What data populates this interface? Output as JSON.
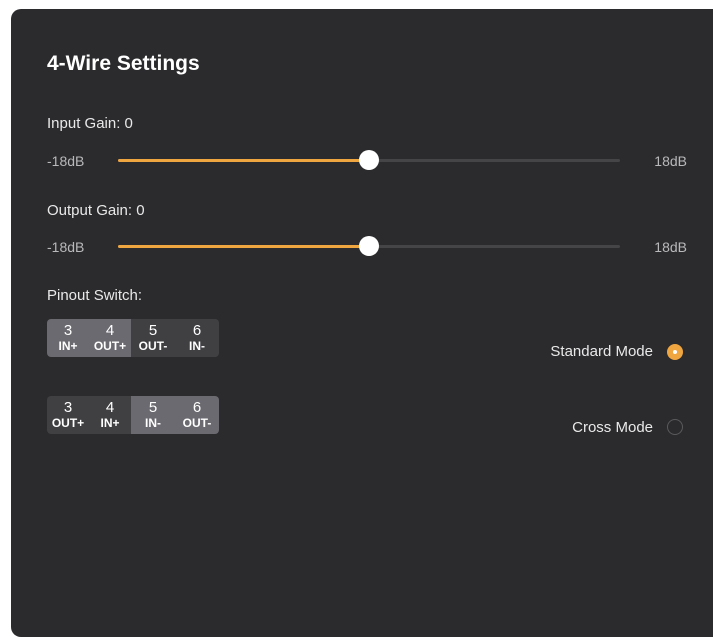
{
  "panel": {
    "title": "4-Wire Settings"
  },
  "input_gain": {
    "label": "Input Gain: 0",
    "min_label": "-18dB",
    "max_label": "18dB",
    "min": -18,
    "max": 18,
    "value": 0
  },
  "output_gain": {
    "label": "Output Gain: 0",
    "min_label": "-18dB",
    "max_label": "18dB",
    "min": -18,
    "max": 18,
    "value": 0
  },
  "pinout": {
    "label": "Pinout Switch:",
    "rows": [
      {
        "pins": [
          {
            "num": "3",
            "sig": "IN+"
          },
          {
            "num": "4",
            "sig": "OUT+"
          },
          {
            "num": "5",
            "sig": "OUT-"
          },
          {
            "num": "6",
            "sig": "IN-"
          }
        ],
        "highlighted_pair": "first"
      },
      {
        "pins": [
          {
            "num": "3",
            "sig": "OUT+"
          },
          {
            "num": "4",
            "sig": "IN+"
          },
          {
            "num": "5",
            "sig": "IN-"
          },
          {
            "num": "6",
            "sig": "OUT-"
          }
        ],
        "highlighted_pair": "second"
      }
    ]
  },
  "modes": {
    "standard": {
      "label": "Standard Mode",
      "selected": true
    },
    "cross": {
      "label": "Cross Mode",
      "selected": false
    }
  },
  "colors": {
    "accent": "#f0a640",
    "panel_bg": "#2b2b2d",
    "highlight_bg": "#6a6a70",
    "group_bg": "#404043"
  }
}
